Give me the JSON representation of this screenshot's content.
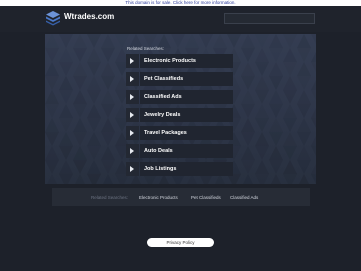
{
  "notice": {
    "text": "This domain is for sale. Click here for more information."
  },
  "header": {
    "site_title": "Wtrades.com",
    "logo_icon": "stacked-layers-icon",
    "search": {
      "placeholder": "",
      "value": ""
    }
  },
  "main": {
    "related_label": "Related Searches:",
    "links": [
      {
        "label": "Electronic Products",
        "icon": "chevron-right-icon"
      },
      {
        "label": "Pet Classifieds",
        "icon": "chevron-right-icon"
      },
      {
        "label": "Classified Ads",
        "icon": "chevron-right-icon"
      },
      {
        "label": "Jewelry Deals",
        "icon": "chevron-right-icon"
      },
      {
        "label": "Travel Packages",
        "icon": "chevron-right-icon"
      },
      {
        "label": "Auto Deals",
        "icon": "chevron-right-icon"
      },
      {
        "label": "Job Listings",
        "icon": "chevron-right-icon"
      }
    ]
  },
  "bottom_bar": {
    "related_label": "Related Searches:",
    "links": [
      {
        "label": "Electronic Products"
      },
      {
        "label": "Pet Classifieds"
      },
      {
        "label": "Classified Ads"
      }
    ]
  },
  "footer": {
    "privacy_label": "Privacy Policy"
  },
  "colors": {
    "page_bg": "#1d212a",
    "panel_bg": "#343d52",
    "link_bg": "#202530",
    "notice_text": "#2a3a9a",
    "logo_blue": "#4a78c8"
  }
}
